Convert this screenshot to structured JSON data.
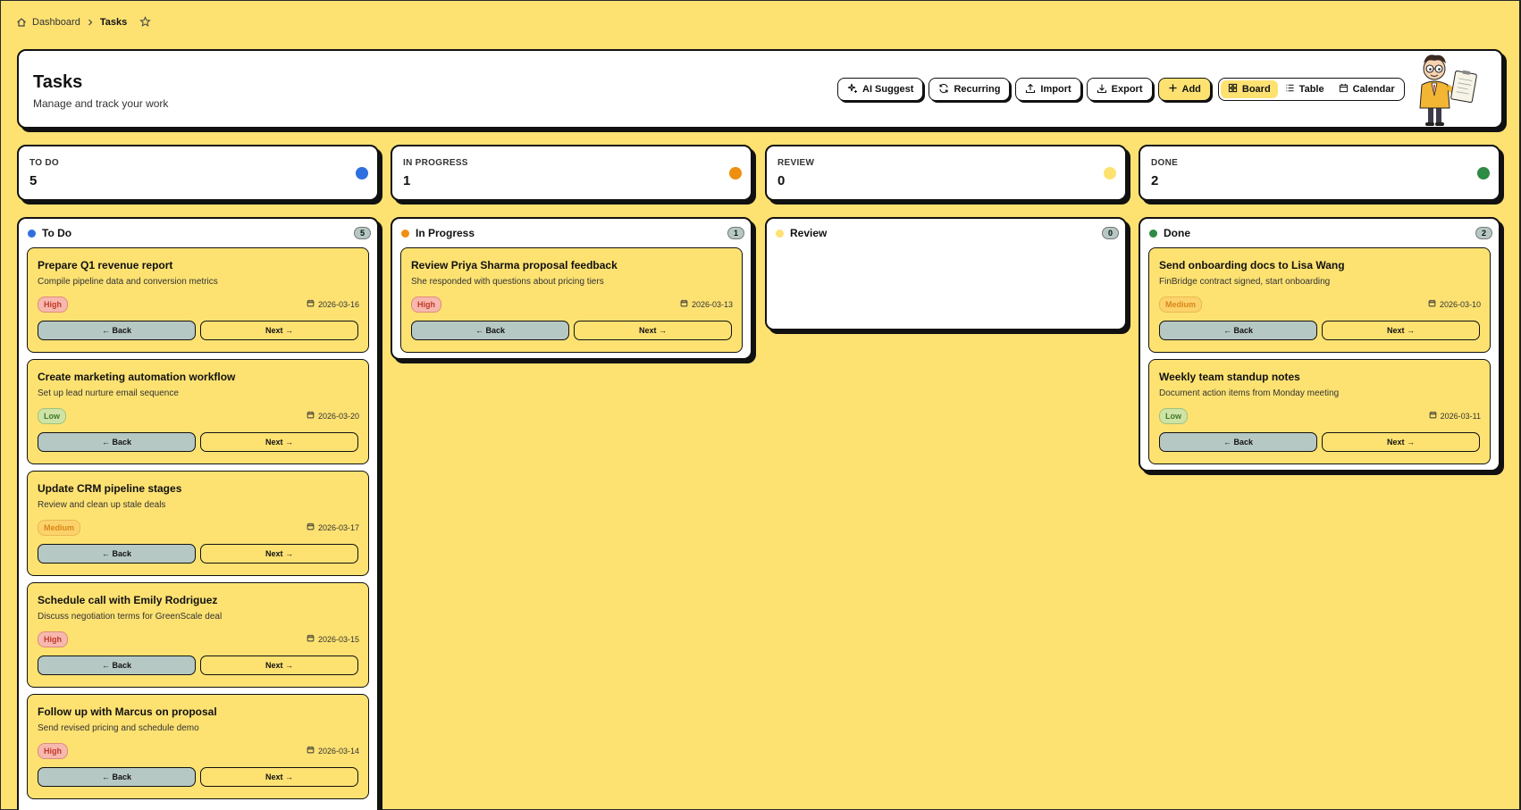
{
  "breadcrumb": {
    "home_label": "Dashboard",
    "current_label": "Tasks"
  },
  "header": {
    "title": "Tasks",
    "subtitle": "Manage and track your work",
    "buttons": {
      "ai_suggest": "AI Suggest",
      "recurring": "Recurring",
      "import": "Import",
      "export": "Export",
      "add": "Add"
    },
    "views": {
      "board": "Board",
      "table": "Table",
      "calendar": "Calendar",
      "active": "Board"
    }
  },
  "colors": {
    "background": "#fde272",
    "todo": "#2f6fdf",
    "in_progress": "#ee8f12",
    "review": "#fde272",
    "done": "#2e8b45",
    "back_button": "#b6c8c4"
  },
  "stats": [
    {
      "label": "TO DO",
      "count": "5"
    },
    {
      "label": "IN PROGRESS",
      "count": "1"
    },
    {
      "label": "REVIEW",
      "count": "0"
    },
    {
      "label": "DONE",
      "count": "2"
    }
  ],
  "columns": [
    {
      "name": "To Do",
      "count": "5",
      "tasks": [
        {
          "title": "Prepare Q1 revenue report",
          "description": "Compile pipeline data and conversion metrics",
          "priority": "High",
          "date": "2026-03-16",
          "back": "← Back",
          "next": "Next →"
        },
        {
          "title": "Create marketing automation workflow",
          "description": "Set up lead nurture email sequence",
          "priority": "Low",
          "date": "2026-03-20",
          "back": "← Back",
          "next": "Next →"
        },
        {
          "title": "Update CRM pipeline stages",
          "description": "Review and clean up stale deals",
          "priority": "Medium",
          "date": "2026-03-17",
          "back": "← Back",
          "next": "Next →"
        },
        {
          "title": "Schedule call with Emily Rodriguez",
          "description": "Discuss negotiation terms for GreenScale deal",
          "priority": "High",
          "date": "2026-03-15",
          "back": "← Back",
          "next": "Next →"
        },
        {
          "title": "Follow up with Marcus on proposal",
          "description": "Send revised pricing and schedule demo",
          "priority": "High",
          "date": "2026-03-14",
          "back": "← Back",
          "next": "Next →"
        }
      ]
    },
    {
      "name": "In Progress",
      "count": "1",
      "tasks": [
        {
          "title": "Review Priya Sharma proposal feedback",
          "description": "She responded with questions about pricing tiers",
          "priority": "High",
          "date": "2026-03-13",
          "back": "← Back",
          "next": "Next →"
        }
      ]
    },
    {
      "name": "Review",
      "count": "0",
      "tasks": []
    },
    {
      "name": "Done",
      "count": "2",
      "tasks": [
        {
          "title": "Send onboarding docs to Lisa Wang",
          "description": "FinBridge contract signed, start onboarding",
          "priority": "Medium",
          "date": "2026-03-10",
          "back": "← Back",
          "next": "Next →"
        },
        {
          "title": "Weekly team standup notes",
          "description": "Document action items from Monday meeting",
          "priority": "Low",
          "date": "2026-03-11",
          "back": "← Back",
          "next": "Next →"
        }
      ]
    }
  ]
}
